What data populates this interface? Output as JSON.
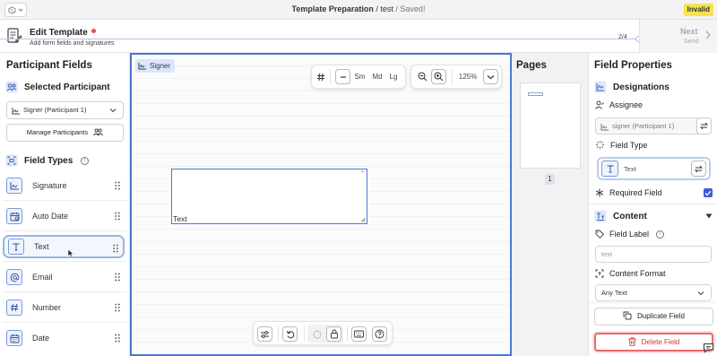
{
  "topbar": {
    "title_bold": "Template Preparation",
    "title_rest": " / test",
    "title_status": " / Saved!",
    "status_badge": "Invalid",
    "badge_color": "#f7e34e"
  },
  "header": {
    "title": "Edit Template",
    "subtitle": "Add form fields and signatures",
    "step": "2/4",
    "next_label": "Next",
    "next_sub": "Send"
  },
  "left": {
    "title": "Participant Fields",
    "selected_participant_heading": "Selected Participant",
    "participant_select_value": "Signer (Participant 1)",
    "manage_button": "Manage Participants",
    "field_types_heading": "Field Types",
    "field_types": [
      {
        "label": "Signature",
        "icon": "signature-icon"
      },
      {
        "label": "Auto Date",
        "icon": "auto-date-icon"
      },
      {
        "label": "Text",
        "icon": "text-icon"
      },
      {
        "label": "Email",
        "icon": "at-icon"
      },
      {
        "label": "Number",
        "icon": "hash-icon"
      },
      {
        "label": "Date",
        "icon": "calendar-icon"
      }
    ],
    "active_field_type": "Text"
  },
  "canvas": {
    "signer_chip": "Signer",
    "size_buttons": [
      "Sm",
      "Md",
      "Lg"
    ],
    "zoom_level": "125%",
    "field_value": "Text",
    "required_marker": "*",
    "accent": "#4a78d4"
  },
  "pages": {
    "title": "Pages",
    "page_numbers": [
      "1"
    ]
  },
  "properties": {
    "title": "Field Properties",
    "designations_heading": "Designations",
    "assignee_label": "Assignee",
    "assignee_value": "signer (Participant 1)",
    "field_type_label": "Field Type",
    "field_type_value": "Text",
    "required_label": "Required Field",
    "required_checked": true,
    "content_heading": "Content",
    "field_label_label": "Field Label",
    "field_label_placeholder": "text",
    "content_format_label": "Content Format",
    "content_format_value": "Any Text",
    "duplicate_button": "Duplicate Field",
    "delete_button": "Delete Field",
    "delete_color": "#d33333"
  }
}
